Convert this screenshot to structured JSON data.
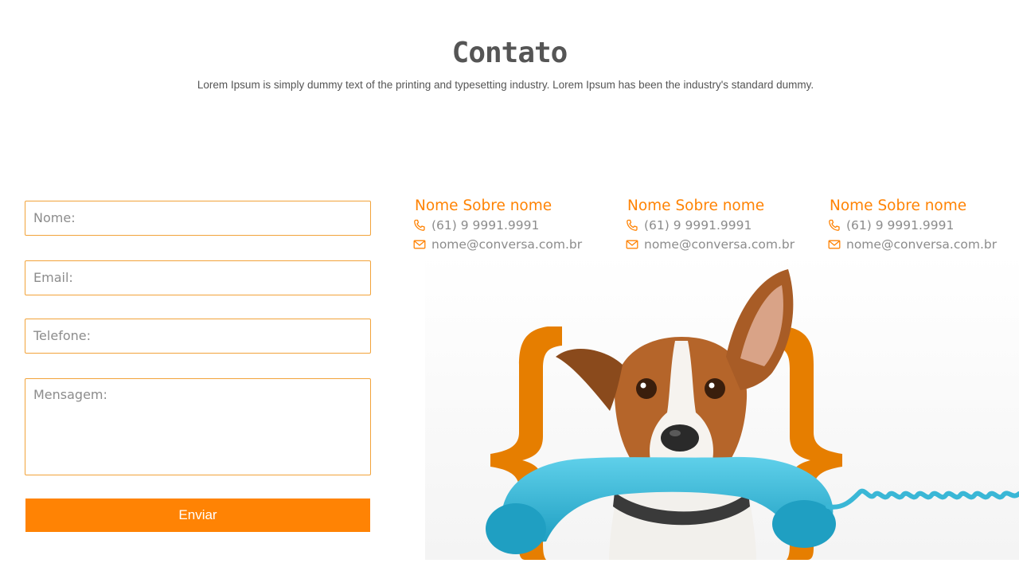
{
  "header": {
    "title": "Contato",
    "subtitle": "Lorem Ipsum is simply dummy text of the printing and typesetting industry. Lorem Ipsum has been the industry's standard dummy."
  },
  "form": {
    "nome_placeholder": "Nome:",
    "email_placeholder": "Email:",
    "telefone_placeholder": "Telefone:",
    "mensagem_placeholder": "Mensagem:",
    "submit_label": "Enviar"
  },
  "contacts": [
    {
      "name": "Nome Sobre nome",
      "phone": "(61) 9 9991.9991",
      "email": "nome@conversa.com.br"
    },
    {
      "name": "Nome Sobre nome",
      "phone": "(61) 9 9991.9991",
      "email": "nome@conversa.com.br"
    },
    {
      "name": "Nome Sobre nome",
      "phone": "(61) 9 9991.9991",
      "email": "nome@conversa.com.br"
    }
  ],
  "icons": {
    "phone": "phone-icon",
    "email": "envelope-icon"
  },
  "illustration": {
    "subject": "dog holding telephone handset in mouth between orange curly braces"
  },
  "colors": {
    "accent": "#ff8304",
    "field_border": "#f2a33a",
    "text_gray": "#8c8c8c",
    "heading_gray": "#555555",
    "handset_blue": "#3ab7d6"
  }
}
